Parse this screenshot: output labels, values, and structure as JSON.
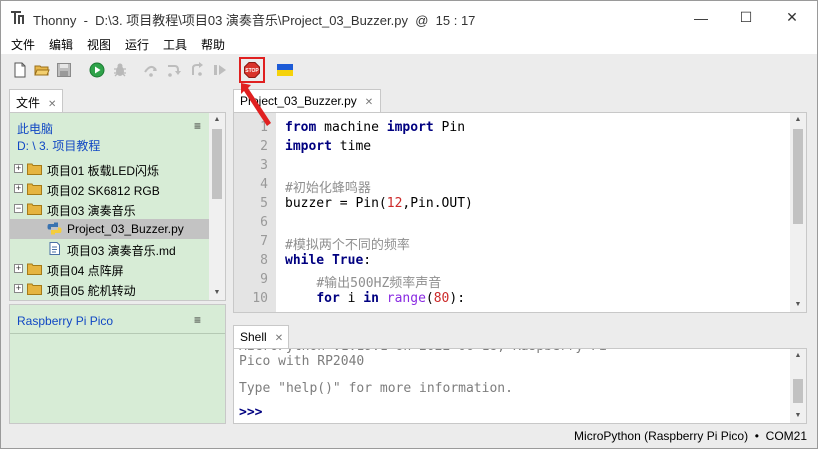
{
  "window": {
    "app_name": "Thonny",
    "path": "D:\\3. 项目教程\\项目03 演奏音乐\\Project_03_Buzzer.py",
    "separator": "@",
    "cursor": "15 : 17"
  },
  "window_controls": {
    "minimize": "—",
    "maximize": "☐",
    "close": "✕"
  },
  "menu": [
    "文件",
    "编辑",
    "视图",
    "运行",
    "工具",
    "帮助"
  ],
  "toolbar": {
    "icons": [
      "new-file-icon",
      "open-folder-icon",
      "save-icon",
      "run-icon",
      "debug-icon",
      "step-over-icon",
      "step-into-icon",
      "step-out-icon",
      "resume-icon",
      "stop-icon",
      "ukraine-flag-icon"
    ],
    "stop_label": "STOP"
  },
  "files": {
    "tab_label": "文件",
    "section_title": "此电脑",
    "current_path": "D: \\ 3. 项目教程",
    "items": [
      {
        "label": "项目01 板载LED闪烁",
        "type": "folder",
        "expander": "+"
      },
      {
        "label": "项目02 SK6812 RGB",
        "type": "folder",
        "expander": "+"
      },
      {
        "label": "项目03 演奏音乐",
        "type": "folder",
        "expander": "−"
      },
      {
        "label": "Project_03_Buzzer.py",
        "type": "python-file",
        "selected": true
      },
      {
        "label": "项目03 演奏音乐.md",
        "type": "file"
      },
      {
        "label": "项目04 点阵屏",
        "type": "folder",
        "expander": "+"
      },
      {
        "label": "项目05 舵机转动",
        "type": "folder",
        "expander": "+"
      }
    ]
  },
  "device_panel": {
    "title": "Raspberry Pi Pico"
  },
  "editor": {
    "tab_label": "Project_03_Buzzer.py",
    "line_numbers": [
      "1",
      "2",
      "3",
      "4",
      "5",
      "6",
      "7",
      "8",
      "9",
      "10"
    ],
    "lines": [
      [
        {
          "t": "from",
          "c": "kw"
        },
        {
          "t": " machine ",
          "c": ""
        },
        {
          "t": "import",
          "c": "kw"
        },
        {
          "t": " Pin",
          "c": ""
        }
      ],
      [
        {
          "t": "import",
          "c": "kw"
        },
        {
          "t": " time",
          "c": ""
        }
      ],
      [],
      [
        {
          "t": "#初始化蜂鸣器",
          "c": "cm"
        }
      ],
      [
        {
          "t": "buzzer = Pin(",
          "c": ""
        },
        {
          "t": "12",
          "c": "num"
        },
        {
          "t": ",Pin.OUT)",
          "c": ""
        }
      ],
      [],
      [
        {
          "t": "#模拟两个不同的频率",
          "c": "cm"
        }
      ],
      [
        {
          "t": "while",
          "c": "kw"
        },
        {
          "t": " ",
          "c": ""
        },
        {
          "t": "True",
          "c": "kw"
        },
        {
          "t": ":",
          "c": ""
        }
      ],
      [
        {
          "t": "    ",
          "c": ""
        },
        {
          "t": "#输出500HZ频率声音",
          "c": "cm"
        }
      ],
      [
        {
          "t": "    ",
          "c": ""
        },
        {
          "t": "for",
          "c": "kw"
        },
        {
          "t": " i ",
          "c": ""
        },
        {
          "t": "in",
          "c": "kw"
        },
        {
          "t": " ",
          "c": ""
        },
        {
          "t": "range",
          "c": "bi"
        },
        {
          "t": "(",
          "c": ""
        },
        {
          "t": "80",
          "c": "num"
        },
        {
          "t": "):",
          "c": ""
        }
      ]
    ]
  },
  "shell": {
    "tab_label": "Shell",
    "lines": [
      "Pico with RP2040",
      "Type \"help()\" for more information."
    ],
    "prompt": ">>>"
  },
  "status": {
    "interpreter": "MicroPython (Raspberry Pi Pico)",
    "separator": "•",
    "port": "COM21"
  },
  "colors": {
    "panel_bg": "#d7ecd6",
    "link_blue": "#1148c4",
    "keyword": "#000080",
    "annotation_red": "#e02020"
  }
}
